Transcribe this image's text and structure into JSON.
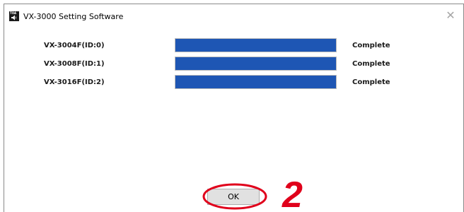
{
  "window": {
    "title": "VX-3000 Setting Software",
    "icon_brand": "TOA",
    "close_glyph": "✕"
  },
  "devices": [
    {
      "name": "VX-3004F(ID:0)",
      "progress_percent": 100,
      "status": "Complete"
    },
    {
      "name": "VX-3008F(ID:1)",
      "progress_percent": 100,
      "status": "Complete"
    },
    {
      "name": "VX-3016F(ID:2)",
      "progress_percent": 100,
      "status": "Complete"
    }
  ],
  "ok_button": {
    "label": "OK"
  },
  "annotation": {
    "step": "2",
    "color": "#e0001b"
  },
  "colors": {
    "progress_fill": "#1e56b4"
  }
}
